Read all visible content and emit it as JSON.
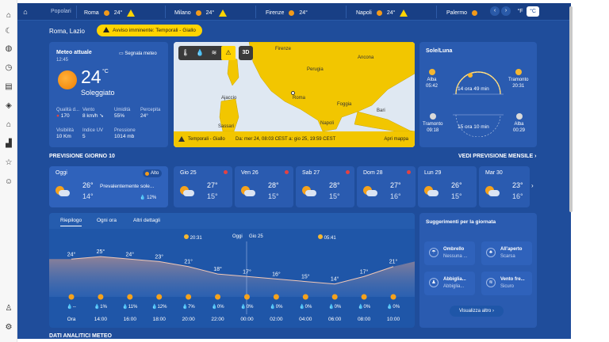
{
  "topbar": {
    "popular_label": "Popolari",
    "cities": [
      {
        "name": "Roma",
        "temp": "24°",
        "warning": true
      },
      {
        "name": "Milano",
        "temp": "24°",
        "warning": true
      },
      {
        "name": "Firenze",
        "temp": "24°",
        "warning": false
      },
      {
        "name": "Napoli",
        "temp": "24°",
        "warning": true
      },
      {
        "name": "Palermo",
        "temp": "",
        "warning": false
      }
    ],
    "unit_f": "°F",
    "unit_c": "°C"
  },
  "location": "Roma, Lazio",
  "alert_pill": "Avviso imminente: Temporali - Giallo",
  "current": {
    "heading": "Meteo attuale",
    "time": "12:45",
    "report_label": "Segnala meteo",
    "temp": "24",
    "unit": "°C",
    "description": "Soleggiato",
    "stats": [
      {
        "label": "Qualità d...",
        "value": "170"
      },
      {
        "label": "Vento",
        "value": "8 km/h"
      },
      {
        "label": "Umidità",
        "value": "55%"
      },
      {
        "label": "Percepita",
        "value": "24°"
      },
      {
        "label": "Visibilità",
        "value": "10 Km"
      },
      {
        "label": "Indice UV",
        "value": "5"
      },
      {
        "label": "Pressione",
        "value": "1014 mb"
      }
    ]
  },
  "map": {
    "places": [
      "Firenze",
      "Perugia",
      "Ancona",
      "Ajaccio",
      "Roma",
      "Foggia",
      "Bari",
      "Napoli",
      "Sassari"
    ],
    "layer_3d": "3D",
    "alert_title": "Temporali - Giallo",
    "alert_range": "Da: mer 24, 08:03 CEST a: gio 25, 19:59 CEST",
    "open_map": "Apri mappa",
    "colors": {
      "warning": "#f2c600",
      "sea": "#dfe8f2"
    }
  },
  "sunmoon": {
    "title": "Sole/Luna",
    "sunrise_label": "Alba",
    "sunrise": "05:42",
    "sunset_label": "Tramonto",
    "sunset": "20:31",
    "daylight": "14 ora 49 min",
    "moonset_label": "Tramonto",
    "moonset": "09:18",
    "moonrise_label": "Alba",
    "moonrise": "00:29",
    "moonlight": "15 ora 10 min"
  },
  "forecast": {
    "title": "PREVISIONE GIORNO 10",
    "monthly_link": "VEDI PREVISIONE MENSILE",
    "today": {
      "label": "Oggi",
      "badge": "Alto",
      "hi": "26°",
      "lo": "14°",
      "summary": "Prevalentemente sole...",
      "precip": "12%"
    },
    "days": [
      {
        "label": "Gio 25",
        "hi": "27°",
        "lo": "15°",
        "alert": true
      },
      {
        "label": "Ven 26",
        "hi": "28°",
        "lo": "15°",
        "alert": true
      },
      {
        "label": "Sab 27",
        "hi": "28°",
        "lo": "15°",
        "alert": true
      },
      {
        "label": "Dom 28",
        "hi": "27°",
        "lo": "16°",
        "alert": true
      },
      {
        "label": "Lun 29",
        "hi": "26°",
        "lo": "15°",
        "alert": false
      },
      {
        "label": "Mar 30",
        "hi": "23°",
        "lo": "16°",
        "alert": false
      }
    ]
  },
  "hourly": {
    "tabs": [
      "Riepilogo",
      "Ogni ora",
      "Altri dettagli"
    ],
    "sunset_time": "20:31",
    "today_label": "Oggi",
    "next_day_label": "Gio 25",
    "sunrise_time": "05:41",
    "chart_data": {
      "type": "area",
      "x": [
        "Ora",
        "14:00",
        "16:00",
        "18:00",
        "20:00",
        "22:00",
        "00:00",
        "02:00",
        "04:00",
        "06:00",
        "08:00",
        "10:00"
      ],
      "series": [
        {
          "values": [
            24,
            25,
            24,
            23,
            21,
            18,
            17,
            16,
            15,
            14,
            17,
            21
          ]
        }
      ],
      "temp_labels": [
        "24°",
        "25°",
        "24°",
        "23°",
        "21°",
        "18°",
        "17°",
        "16°",
        "15°",
        "14°",
        "17°",
        "21°"
      ],
      "precip": [
        "--",
        "1%",
        "11%",
        "12%",
        "7%",
        "0%",
        "0%",
        "0%",
        "0%",
        "0%",
        "0%",
        "0%"
      ]
    }
  },
  "suggestions": {
    "title": "Suggerimenti per la giornata",
    "items": [
      {
        "title": "Ombrello",
        "value": "Nessuna ..."
      },
      {
        "title": "All'aperto",
        "value": "Scarsa"
      },
      {
        "title": "Abbiglia...",
        "value": "Abbiglia..."
      },
      {
        "title": "Vento fre...",
        "value": "Sicuro"
      }
    ],
    "more_label": "Visualizza altro"
  },
  "bottom_title": "DATI ANALITICI METEO"
}
